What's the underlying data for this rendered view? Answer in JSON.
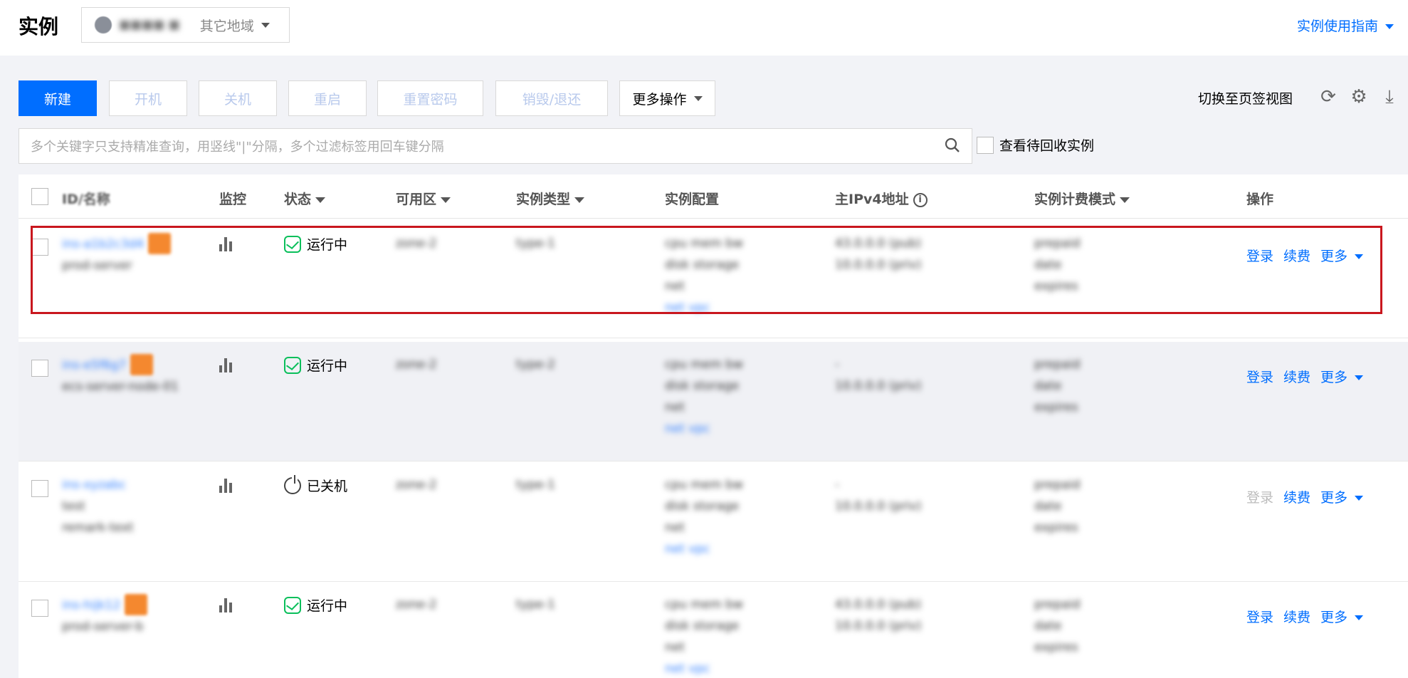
{
  "header": {
    "title": "实例",
    "region_label": "■■■■ ■",
    "region_other": "其它地域",
    "guide_link": "实例使用指南"
  },
  "toolbar": {
    "new": "新建",
    "start": "开机",
    "stop": "关机",
    "restart": "重启",
    "reset_password": "重置密码",
    "destroy": "销毁/退还",
    "more_actions": "更多操作",
    "switch_view": "切换至页签视图"
  },
  "search": {
    "placeholder": "多个关键字只支持精准查询，用竖线\"|\"分隔，多个过滤标签用回车键分隔",
    "recycle_label": "查看待回收实例"
  },
  "table": {
    "columns": {
      "id_name": "ID/名称",
      "monitor": "监控",
      "status": "状态",
      "zone": "可用区",
      "type": "实例类型",
      "config": "实例配置",
      "ipv4": "主IPv4地址",
      "billing": "实例计费模式",
      "actions": "操作"
    },
    "rows": [
      {
        "status": "运行中",
        "status_kind": "running",
        "login": "登录",
        "renew": "续费",
        "more": "更多"
      },
      {
        "status": "运行中",
        "status_kind": "running",
        "login": "登录",
        "renew": "续费",
        "more": "更多"
      },
      {
        "status": "已关机",
        "status_kind": "stopped",
        "login": "登录",
        "renew": "续费",
        "more": "更多"
      },
      {
        "status": "运行中",
        "status_kind": "running",
        "login": "登录",
        "renew": "续费",
        "more": "更多"
      }
    ]
  },
  "colors": {
    "primary": "#006eff",
    "running": "#0abf5b",
    "highlight_border": "#c9171e"
  }
}
